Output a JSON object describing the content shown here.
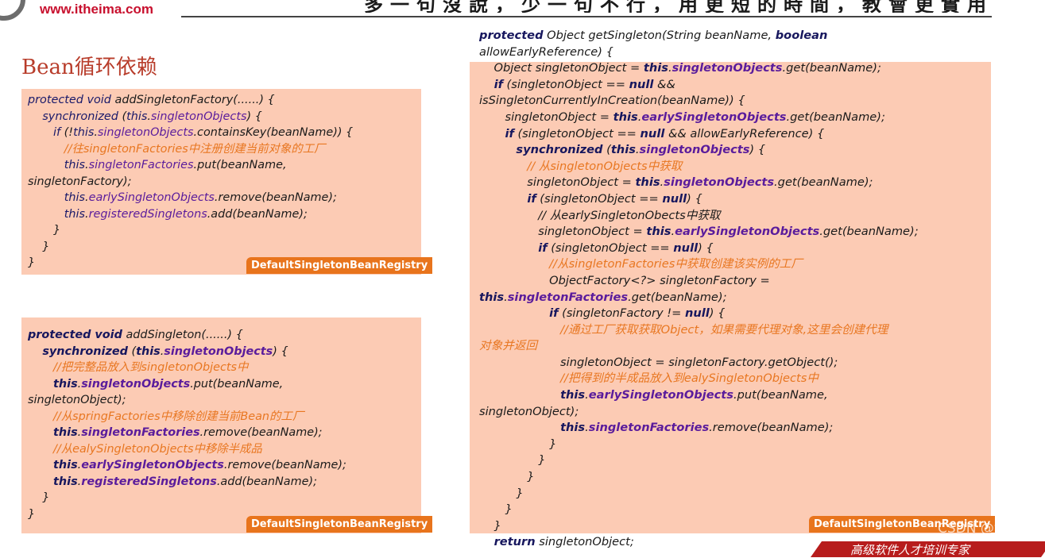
{
  "header": {
    "logo_url": "www.itheima.com",
    "banner_fragment": "多一句沒說，少一句不行，用更短的時間，教會更實用的技術！",
    "footer_fragment": "高级软件人才培训专家"
  },
  "page_title": "Bean循环依赖",
  "watermark": "CSDN @wljt",
  "panels": [
    {
      "tag": "DefaultSingletonBeanRegistry",
      "lines": [
        [
          [
            "kw",
            "protected void"
          ],
          [
            "t",
            " addSingletonFactory(......) {"
          ]
        ],
        [
          [
            "t",
            "    "
          ],
          [
            "kw",
            "synchronized"
          ],
          [
            "t",
            " ("
          ],
          [
            "kw",
            "this"
          ],
          [
            "t",
            "."
          ],
          [
            "fld",
            "singletonObjects"
          ],
          [
            "t",
            ") {"
          ]
        ],
        [
          [
            "t",
            "       "
          ],
          [
            "kw",
            "if"
          ],
          [
            "t",
            " (!"
          ],
          [
            "kw",
            "this"
          ],
          [
            "t",
            "."
          ],
          [
            "fld",
            "singletonObjects"
          ],
          [
            "t",
            ".containsKey(beanName)) {"
          ]
        ],
        [
          [
            "t",
            "          "
          ],
          [
            "cmt",
            "//往singletonFactories中注册创建当前对象的工厂"
          ]
        ],
        [
          [
            "t",
            "          "
          ],
          [
            "kw",
            "this"
          ],
          [
            "t",
            "."
          ],
          [
            "fld",
            "singletonFactories"
          ],
          [
            "t",
            ".put(beanName,"
          ]
        ],
        [
          [
            "t",
            "singletonFactory);"
          ]
        ],
        [
          [
            "t",
            "          "
          ],
          [
            "kw",
            "this"
          ],
          [
            "t",
            "."
          ],
          [
            "fld",
            "earlySingletonObjects"
          ],
          [
            "t",
            ".remove(beanName);"
          ]
        ],
        [
          [
            "t",
            "          "
          ],
          [
            "kw",
            "this"
          ],
          [
            "t",
            "."
          ],
          [
            "fld",
            "registeredSingletons"
          ],
          [
            "t",
            ".add(beanName);"
          ]
        ],
        [
          [
            "t",
            "       }"
          ]
        ],
        [
          [
            "t",
            "    }"
          ]
        ],
        [
          [
            "t",
            "}"
          ]
        ]
      ]
    },
    {
      "tag": "DefaultSingletonBeanRegistry",
      "lines": [
        [
          [
            "kwb",
            "protected void"
          ],
          [
            "t",
            " addSingleton(......) {"
          ]
        ],
        [
          [
            "t",
            "    "
          ],
          [
            "kwb",
            "synchronized"
          ],
          [
            "t",
            " ("
          ],
          [
            "kwb",
            "this"
          ],
          [
            "t",
            "."
          ],
          [
            "fldb",
            "singletonObjects"
          ],
          [
            "t",
            ") {"
          ]
        ],
        [
          [
            "t",
            "       "
          ],
          [
            "cmt",
            "//把完整品放入到singletonObjects中"
          ]
        ],
        [
          [
            "t",
            "       "
          ],
          [
            "kwb",
            "this"
          ],
          [
            "t",
            "."
          ],
          [
            "fldb",
            "singletonObjects"
          ],
          [
            "t",
            ".put(beanName,"
          ]
        ],
        [
          [
            "t",
            "singletonObject);"
          ]
        ],
        [
          [
            "t",
            "       "
          ],
          [
            "cmt",
            "//从springFactories中移除创建当前Bean的工厂"
          ]
        ],
        [
          [
            "t",
            "       "
          ],
          [
            "kwb",
            "this"
          ],
          [
            "t",
            "."
          ],
          [
            "fldb",
            "singletonFactories"
          ],
          [
            "t",
            ".remove(beanName);"
          ]
        ],
        [
          [
            "t",
            "       "
          ],
          [
            "cmt",
            "//从ealySingletonObjects中移除半成品"
          ]
        ],
        [
          [
            "t",
            "       "
          ],
          [
            "kwb",
            "this"
          ],
          [
            "t",
            "."
          ],
          [
            "fldb",
            "earlySingletonObjects"
          ],
          [
            "t",
            ".remove(beanName);"
          ]
        ],
        [
          [
            "t",
            "       "
          ],
          [
            "kwb",
            "this"
          ],
          [
            "t",
            "."
          ],
          [
            "fldb",
            "registeredSingletons"
          ],
          [
            "t",
            ".add(beanName);"
          ]
        ],
        [
          [
            "t",
            "    }"
          ]
        ],
        [
          [
            "t",
            "}"
          ]
        ]
      ]
    },
    {
      "tag": "DefaultSingletonBeanRegistry",
      "lines": [
        [
          [
            "kwb",
            "protected"
          ],
          [
            "t",
            " Object getSingleton(String beanName, "
          ],
          [
            "kwb",
            "boolean"
          ]
        ],
        [
          [
            "t",
            "allowEarlyReference) {"
          ]
        ],
        [
          [
            "t",
            "    Object singletonObject = "
          ],
          [
            "kwb",
            "this"
          ],
          [
            "t",
            "."
          ],
          [
            "fldb",
            "singletonObjects"
          ],
          [
            "t",
            ".get(beanName);"
          ]
        ],
        [
          [
            "t",
            "    "
          ],
          [
            "kwb",
            "if"
          ],
          [
            "t",
            " (singletonObject == "
          ],
          [
            "kwb",
            "null"
          ],
          [
            "t",
            " &&"
          ]
        ],
        [
          [
            "t",
            "isSingletonCurrentlyInCreation(beanName)) {"
          ]
        ],
        [
          [
            "t",
            "       singletonObject = "
          ],
          [
            "kwb",
            "this"
          ],
          [
            "t",
            "."
          ],
          [
            "fldb",
            "earlySingletonObjects"
          ],
          [
            "t",
            ".get(beanName);"
          ]
        ],
        [
          [
            "t",
            "       "
          ],
          [
            "kwb",
            "if"
          ],
          [
            "t",
            " (singletonObject == "
          ],
          [
            "kwb",
            "null"
          ],
          [
            "t",
            " && allowEarlyReference) {"
          ]
        ],
        [
          [
            "t",
            "          "
          ],
          [
            "kwb",
            "synchronized"
          ],
          [
            "t",
            " ("
          ],
          [
            "kwb",
            "this"
          ],
          [
            "t",
            "."
          ],
          [
            "fldb",
            "singletonObjects"
          ],
          [
            "t",
            ") {"
          ]
        ],
        [
          [
            "t",
            "             "
          ],
          [
            "cmt",
            "// 从singletonObjects中获取"
          ]
        ],
        [
          [
            "t",
            "             singletonObject = "
          ],
          [
            "kwb",
            "this"
          ],
          [
            "t",
            "."
          ],
          [
            "fldb",
            "singletonObjects"
          ],
          [
            "t",
            ".get(beanName);"
          ]
        ],
        [
          [
            "t",
            "             "
          ],
          [
            "kwb",
            "if"
          ],
          [
            "t",
            " (singletonObject == "
          ],
          [
            "kwb",
            "null"
          ],
          [
            "t",
            ") {"
          ]
        ],
        [
          [
            "t",
            "                // 从earlySingletonObects中获取"
          ]
        ],
        [
          [
            "t",
            "                singletonObject = "
          ],
          [
            "kwb",
            "this"
          ],
          [
            "t",
            "."
          ],
          [
            "fldb",
            "earlySingletonObjects"
          ],
          [
            "t",
            ".get(beanName);"
          ]
        ],
        [
          [
            "t",
            "                "
          ],
          [
            "kwb",
            "if"
          ],
          [
            "t",
            " (singletonObject == "
          ],
          [
            "kwb",
            "null"
          ],
          [
            "t",
            ") {"
          ]
        ],
        [
          [
            "t",
            "                   "
          ],
          [
            "cmt",
            "//从singletonFactories中获取创建该实例的工厂"
          ]
        ],
        [
          [
            "t",
            "                   ObjectFactory<?> singletonFactory ="
          ]
        ],
        [
          [
            "kwb",
            "this"
          ],
          [
            "t",
            "."
          ],
          [
            "fldb",
            "singletonFactories"
          ],
          [
            "t",
            ".get(beanName);"
          ]
        ],
        [
          [
            "t",
            "                   "
          ],
          [
            "kwb",
            "if"
          ],
          [
            "t",
            " (singletonFactory != "
          ],
          [
            "kwb",
            "null"
          ],
          [
            "t",
            ") {"
          ]
        ],
        [
          [
            "t",
            "                      "
          ],
          [
            "cmt",
            "//通过工厂获取获取Object，如果需要代理对象,这里会创建代理"
          ]
        ],
        [
          [
            "cmt",
            "对象并返回"
          ]
        ],
        [
          [
            "t",
            "                      singletonObject = singletonFactory.getObject();"
          ]
        ],
        [
          [
            "t",
            "                      "
          ],
          [
            "cmt",
            "//把得到的半成品放入到ealySingletonObjects中"
          ]
        ],
        [
          [
            "t",
            "                      "
          ],
          [
            "kwb",
            "this"
          ],
          [
            "t",
            "."
          ],
          [
            "fldb",
            "earlySingletonObjects"
          ],
          [
            "t",
            ".put(beanName,"
          ]
        ],
        [
          [
            "t",
            "singletonObject);"
          ]
        ],
        [
          [
            "t",
            "                      "
          ],
          [
            "kwb",
            "this"
          ],
          [
            "t",
            "."
          ],
          [
            "fldb",
            "singletonFactories"
          ],
          [
            "t",
            ".remove(beanName);"
          ]
        ],
        [
          [
            "t",
            "                   }"
          ]
        ],
        [
          [
            "t",
            "                }"
          ]
        ],
        [
          [
            "t",
            "             }"
          ]
        ],
        [
          [
            "t",
            "          }"
          ]
        ],
        [
          [
            "t",
            "       }"
          ]
        ],
        [
          [
            "t",
            "    }"
          ]
        ],
        [
          [
            "t",
            "    "
          ],
          [
            "kwb",
            "return"
          ],
          [
            "t",
            " singletonObject;"
          ]
        ]
      ]
    }
  ]
}
